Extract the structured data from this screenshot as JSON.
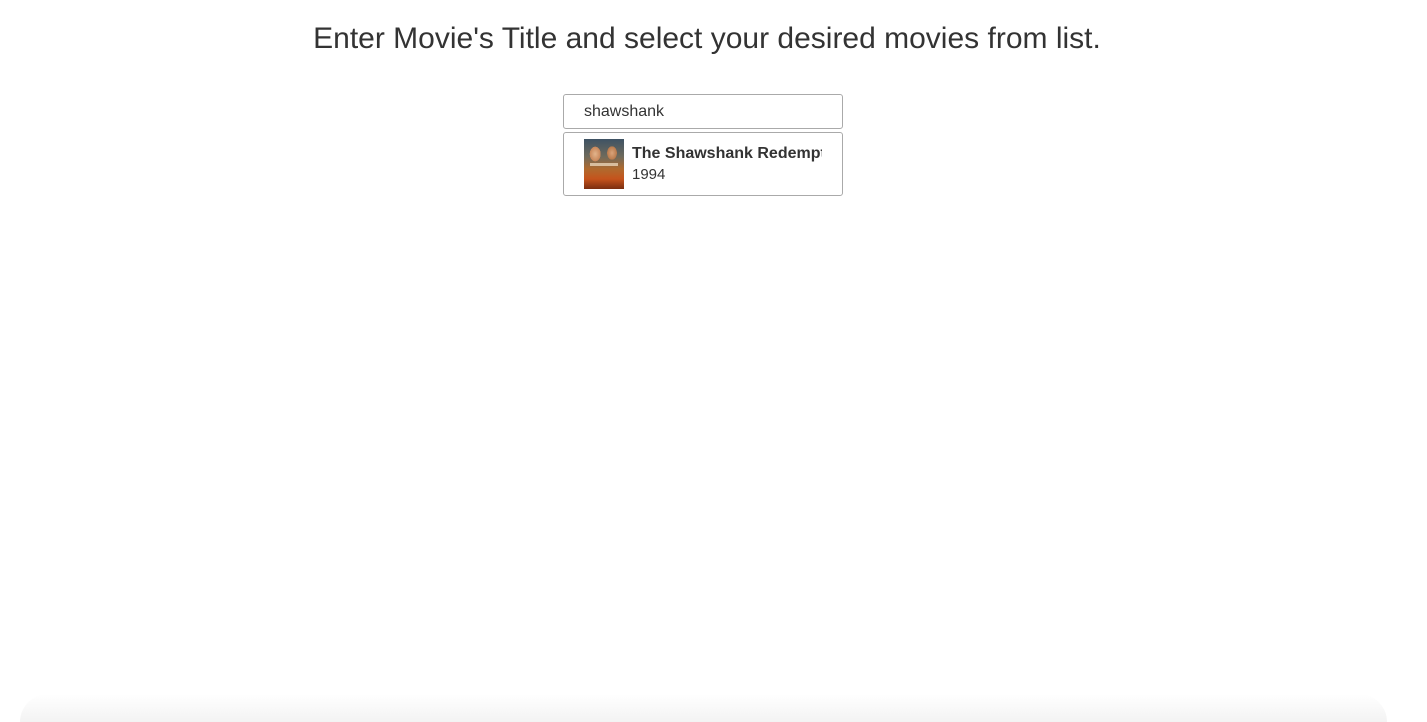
{
  "header": {
    "title": "Enter Movie's Title and select your desired movies from list."
  },
  "search": {
    "value": "shawshank",
    "placeholder": ""
  },
  "results": [
    {
      "title": "The Shawshank Redemption",
      "year": "1994",
      "poster_icon": "movie-poster"
    }
  ]
}
